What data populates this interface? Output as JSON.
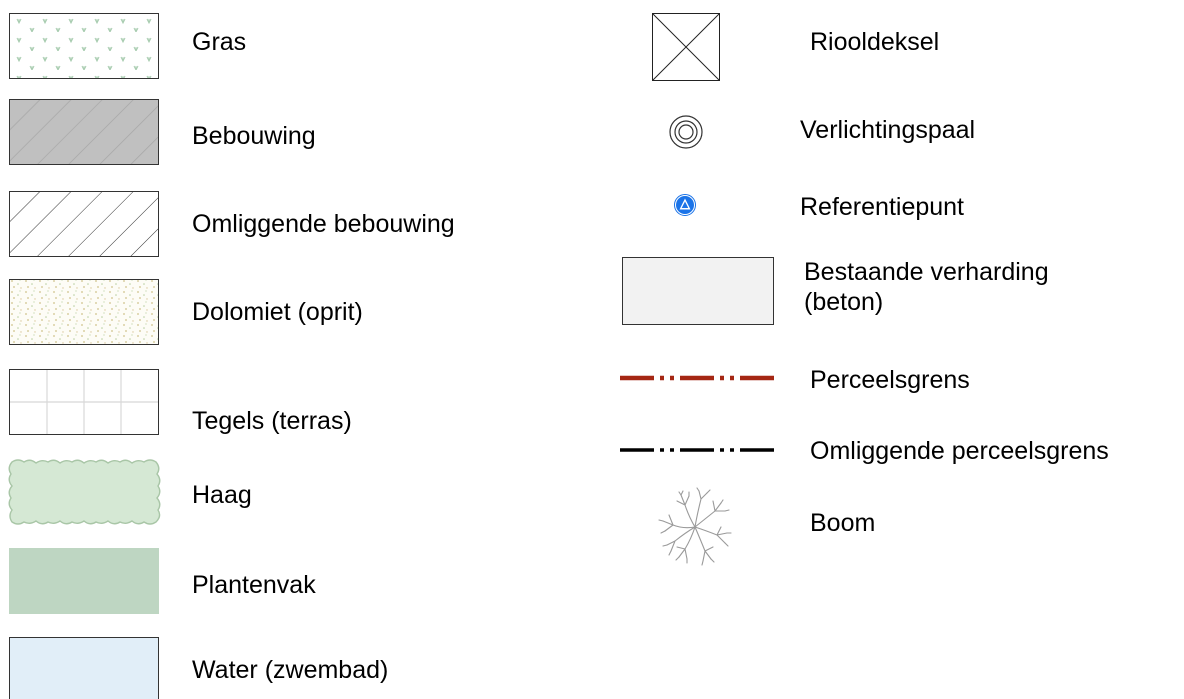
{
  "legend": {
    "left": [
      {
        "key": "gras",
        "label": "Gras"
      },
      {
        "key": "bebouwing",
        "label": "Bebouwing"
      },
      {
        "key": "omliggende_bebouwing",
        "label": "Omliggende bebouwing"
      },
      {
        "key": "dolomiet",
        "label": "Dolomiet (oprit)"
      },
      {
        "key": "tegels",
        "label": "Tegels (terras)"
      },
      {
        "key": "haag",
        "label": "Haag"
      },
      {
        "key": "plantenvak",
        "label": "Plantenvak"
      },
      {
        "key": "water",
        "label": "Water (zwembad)"
      }
    ],
    "right": [
      {
        "key": "riooldeksel",
        "label": "Riooldeksel"
      },
      {
        "key": "verlichtingspaal",
        "label": "Verlichtingspaal"
      },
      {
        "key": "referentiepunt",
        "label": "Referentiepunt"
      },
      {
        "key": "bestaande_verharding",
        "label": "Bestaande verharding\n(beton)"
      },
      {
        "key": "perceelsgrens",
        "label": "Perceelsgrens"
      },
      {
        "key": "omliggende_perceelsgrens",
        "label": "Omliggende perceelsgrens"
      },
      {
        "key": "boom",
        "label": "Boom"
      }
    ]
  },
  "colors": {
    "gras_mark": "#a8ccb0",
    "bebouwing_fill": "#c0c0c0",
    "dolomiet_speckle": "#cfc28a",
    "tegels_grid": "#d8d8d8",
    "haag_fill": "#d5e8d4",
    "haag_stroke": "#a9c6a7",
    "plantenvak_fill": "#bed6c2",
    "water_fill": "#e1eef8",
    "referentiepunt": "#1a73e8",
    "verharding_fill": "#f2f2f2",
    "perceelsgrens": "#a52714",
    "omliggende_perceelsgrens": "#000000",
    "boom_stroke": "#9a9a9a"
  }
}
